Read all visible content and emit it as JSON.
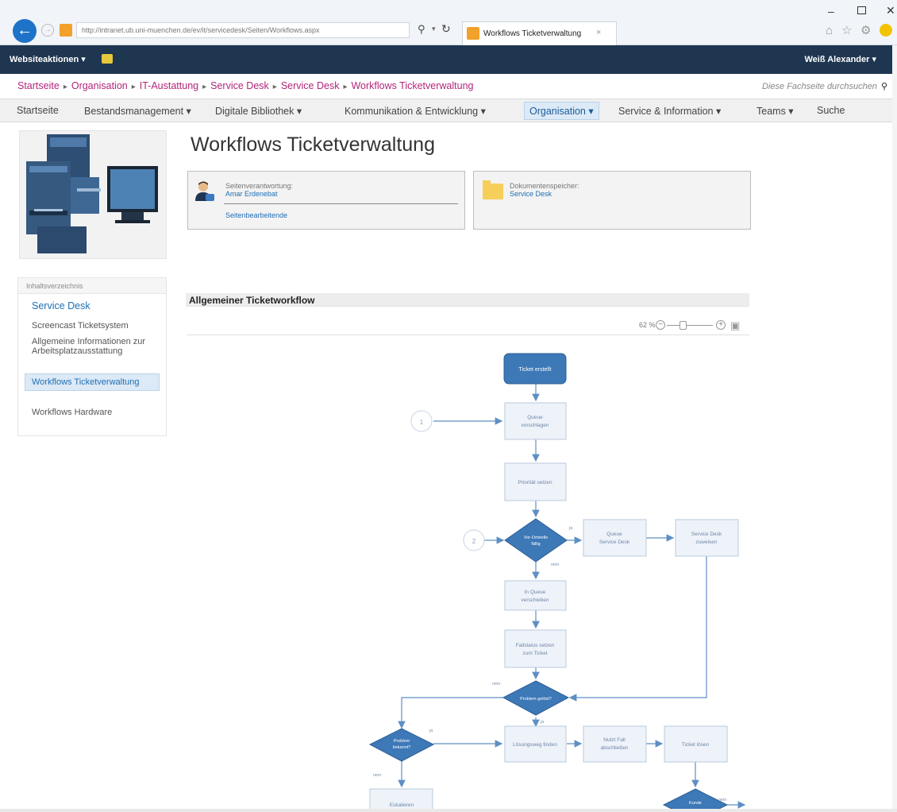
{
  "browser": {
    "address": "http://intranet.ub.uni-muenchen.de/ev/it/servicedesk/Seiten/Workflows.aspx",
    "tab_title": "Workflows Ticketverwaltung",
    "tab_close": "×"
  },
  "suite": {
    "site_actions": "Websiteaktionen ▾",
    "user": "Weiß Alexander ▾"
  },
  "breadcrumb": {
    "items": [
      "Startseite",
      "Organisation",
      "IT-Austattung",
      "Service Desk",
      "Service Desk",
      "Workflows Ticketverwaltung"
    ],
    "separator": "▸",
    "search_placeholder": "Diese Fachseite durchsuchen",
    "search_icon": "⚲"
  },
  "nav": {
    "items": [
      "Startseite",
      "Bestandsmanagement ▾",
      "Digitale Bibliothek ▾",
      "Kommunikation & Entwicklung ▾",
      "Organisation ▾",
      "Service & Information ▾",
      "Teams ▾",
      "Suche"
    ],
    "selected_index": 4
  },
  "toc": {
    "header": "Inhaltsverzeichnis",
    "items": [
      "Service Desk",
      "Screencast Ticketsystem",
      "Allgemeine Informationen zur Arbeitsplatzausstattung",
      "Workflows Ticketverwaltung",
      "Workflows Hardware"
    ],
    "active_index": 3
  },
  "page": {
    "title": "Workflows Ticketverwaltung"
  },
  "responsibility": {
    "label": "Seitenverantwortung:",
    "name": "Amar Erdenebat",
    "editors_link": "Seitenbearbeitende"
  },
  "documents": {
    "label": "Dokumentenspeicher:",
    "link": "Service Desk"
  },
  "section": {
    "title": "Allgemeiner Ticketworkflow"
  },
  "viewer": {
    "zoom": "62 %"
  },
  "flowchart": {
    "nodes": {
      "start": "Ticket erstellt",
      "n1a": "Queue",
      "n1b": "vorschlagen",
      "n2": "Priorität setzen",
      "d1a": "Vor-Ortstelle",
      "d1b": "fällig",
      "n3a": "Queue",
      "n3b": "Service Desk",
      "n4a": "Service Desk",
      "n4b": "zuweisen",
      "n5a": "In Queue",
      "n5b": "verschieben",
      "n6a": "Fallstatus setzen",
      "n6b": "zum Ticket",
      "d2": "Problem gelöst?",
      "d3a": "Problem",
      "d3b": "bekannt?",
      "n7": "Lösungsweg finden",
      "n8a": "Nutzt Fall",
      "n8b": "abschließen",
      "n9": "Ticket lösen",
      "n10": "Eskalieren",
      "d4": "Kunde"
    },
    "connectors": {
      "c1": "1",
      "c2": "2"
    },
    "labels": {
      "ja1": "ja",
      "nein1": "nein",
      "nein2": "nein",
      "ja2": "ja",
      "ja3": "ja",
      "nein3": "nein",
      "nein4": "nein"
    }
  },
  "colors": {
    "suite_bar": "#1e3650",
    "breadcrumb": "#b3257a",
    "link": "#1f6fb5",
    "flow_diamond": "#3d78b7",
    "flow_box_fill": "#eef2f9",
    "flow_box_stroke": "#b9c9de",
    "flow_line": "#5e8fc4"
  }
}
